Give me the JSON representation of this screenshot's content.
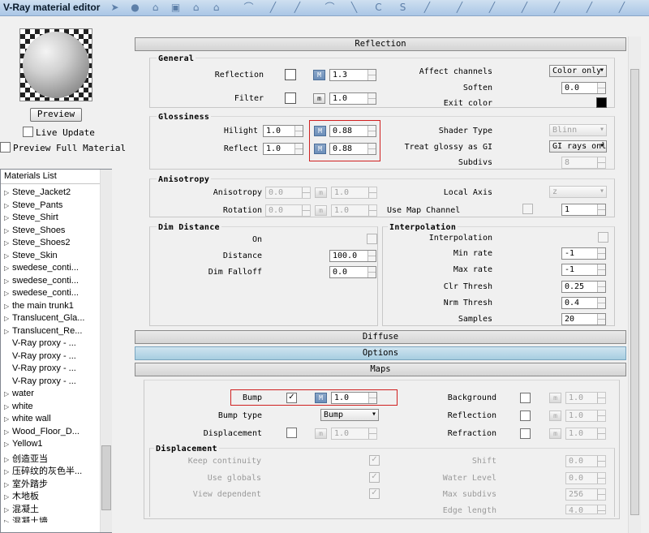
{
  "window": {
    "title": "V-Ray material editor"
  },
  "preview": {
    "button": "Preview",
    "live_update": "Live Update",
    "preview_full": "Preview Full Material"
  },
  "materials": {
    "header": "Materials List",
    "items": [
      "Steve_Jacket2",
      "Steve_Pants",
      "Steve_Shirt",
      "Steve_Shoes",
      "Steve_Shoes2",
      "Steve_Skin",
      "swedese_conti...",
      "swedese_conti...",
      "swedese_conti...",
      "the main trunk1",
      "Translucent_Gla...",
      "Translucent_Re...",
      "V-Ray proxy - ...",
      "V-Ray proxy - ...",
      "V-Ray proxy - ...",
      "V-Ray proxy - ...",
      "water",
      "white",
      "white wall",
      "Wood_Floor_D...",
      "Yellow1",
      "创造亚当",
      "压碎纹的灰色半...",
      "室外踏步",
      "木地板",
      "混凝土",
      "混凝土墙"
    ]
  },
  "rollouts": {
    "reflection": "Reflection",
    "diffuse": "Diffuse",
    "options": "Options",
    "maps": "Maps"
  },
  "general": {
    "title": "General",
    "reflection_label": "Reflection",
    "reflection_value": "1.3",
    "filter_label": "Filter",
    "filter_value": "1.0",
    "affect_label": "Affect channels",
    "affect_value": "Color only",
    "soften_label": "Soften",
    "soften_value": "0.0",
    "exit_color_label": "Exit color",
    "m": "M",
    "m_small": "m"
  },
  "glossiness": {
    "title": "Glossiness",
    "hilight_label": "Hilight",
    "hilight_value": "1.0",
    "hilight_map": "0.88",
    "reflect_label": "Reflect",
    "reflect_value": "1.0",
    "reflect_map": "0.88",
    "shader_label": "Shader Type",
    "shader_value": "Blinn",
    "treat_label": "Treat glossy as GI",
    "treat_value": "GI rays only",
    "subdivs_label": "Subdivs",
    "subdivs_value": "8"
  },
  "anisotropy": {
    "title": "Anisotropy",
    "aniso_label": "Anisotropy",
    "aniso_value": "0.0",
    "aniso_map": "1.0",
    "rotation_label": "Rotation",
    "rotation_value": "0.0",
    "rotation_map": "1.0",
    "local_axis_label": "Local Axis",
    "local_axis_value": "z",
    "map_channel_label": "Use Map Channel",
    "map_channel_value": "1"
  },
  "dim": {
    "title": "Dim Distance",
    "on_label": "On",
    "distance_label": "Distance",
    "distance_value": "100.0",
    "falloff_label": "Dim Falloff",
    "falloff_value": "0.0"
  },
  "interp": {
    "title": "Interpolation",
    "interp_label": "Interpolation",
    "min_label": "Min rate",
    "min_value": "-1",
    "max_label": "Max rate",
    "max_value": "-1",
    "clr_label": "Clr Thresh",
    "clr_value": "0.25",
    "nrm_label": "Nrm Thresh",
    "nrm_value": "0.4",
    "samples_label": "Samples",
    "samples_value": "20"
  },
  "maps": {
    "bump_label": "Bump",
    "bump_value": "1.0",
    "bump_type_label": "Bump type",
    "bump_type_value": "Bump",
    "displacement_label": "Displacement",
    "displacement_value": "1.0",
    "background_label": "Background",
    "background_value": "1.0",
    "reflection_label": "Reflection",
    "reflection_value": "1.0",
    "refraction_label": "Refraction",
    "refraction_value": "1.0"
  },
  "disp": {
    "title": "Displacement",
    "keep_label": "Keep continuity",
    "globals_label": "Use globals",
    "view_label": "View dependent",
    "shift_label": "Shift",
    "shift_value": "0.0",
    "water_label": "Water Level",
    "water_value": "0.0",
    "maxsub_label": "Max subdivs",
    "maxsub_value": "256",
    "edge_label": "Edge length",
    "edge_value": "4.0"
  }
}
